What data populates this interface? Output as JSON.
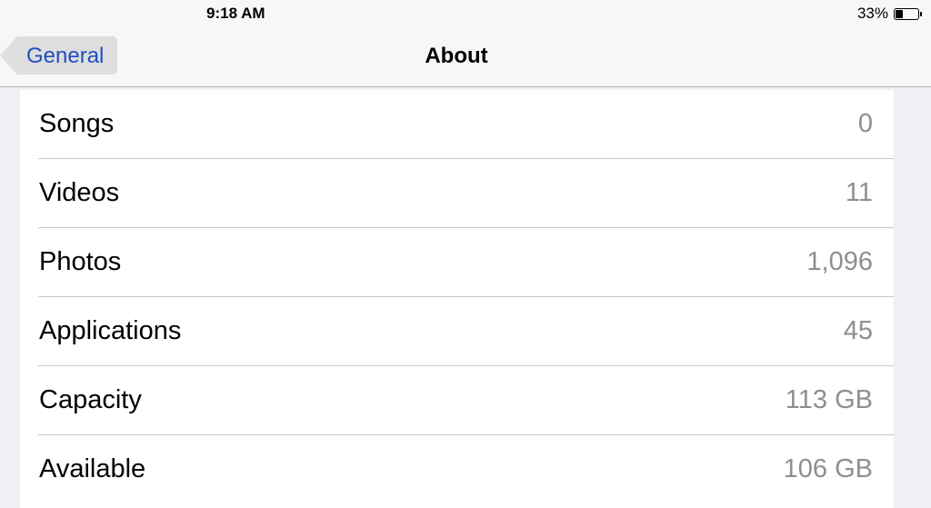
{
  "status_bar": {
    "time": "9:18 AM",
    "battery_percent": "33%",
    "battery_level": 0.33
  },
  "nav": {
    "back_label": "General",
    "title": "About"
  },
  "rows": [
    {
      "label": "Songs",
      "value": "0"
    },
    {
      "label": "Videos",
      "value": "11"
    },
    {
      "label": "Photos",
      "value": "1,096"
    },
    {
      "label": "Applications",
      "value": "45"
    },
    {
      "label": "Capacity",
      "value": "113 GB"
    },
    {
      "label": "Available",
      "value": "106 GB"
    }
  ],
  "colors": {
    "background": "#efeff4",
    "bar": "#f7f7f7",
    "accent": "#1f4fbf",
    "value_text": "#8e8e93",
    "separator": "#c8c7cc"
  }
}
